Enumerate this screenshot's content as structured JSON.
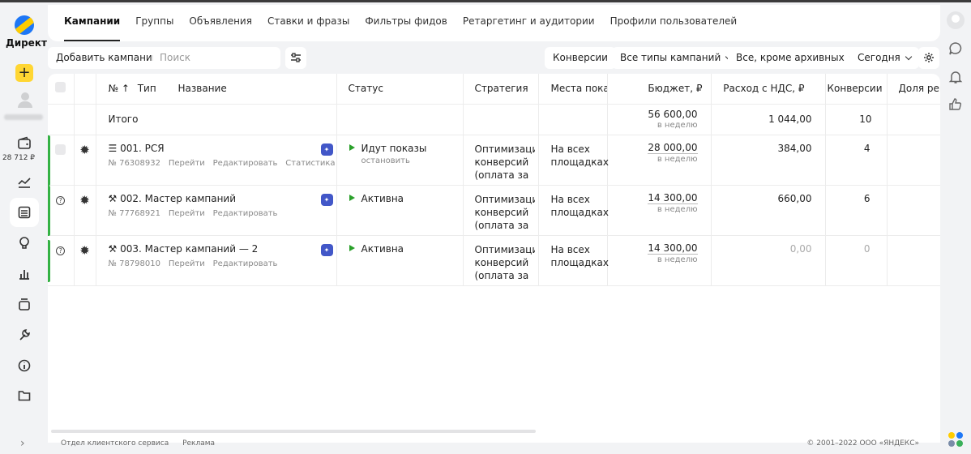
{
  "brand": {
    "name": "Директ"
  },
  "sidebar": {
    "balance": "28 712 ₽"
  },
  "tabs": [
    "Кампании",
    "Группы",
    "Объявления",
    "Ставки и фразы",
    "Фильтры фидов",
    "Ретаргетинг и аудитории",
    "Профили пользователей"
  ],
  "toolbar": {
    "add_campaign": "Добавить кампанию",
    "search_placeholder": "Поиск",
    "conversions": "Конверсии",
    "campaign_types": "Все типы кампаний",
    "archive_filter": "Все, кроме архивных",
    "period": "Сегодня"
  },
  "table": {
    "headers": {
      "num": "№",
      "type": "Тип",
      "name": "Название",
      "status": "Статус",
      "strategy": "Стратегия",
      "placements": "Места показ",
      "budget": "Бюджет, ₽",
      "spend": "Расход с НДС, ₽",
      "conversions": "Конверсии",
      "share": "Доля рекл"
    },
    "total": {
      "label": "Итого",
      "budget": "56 600,00",
      "budget_period": "в неделю",
      "spend": "1 044,00",
      "conversions": "10"
    },
    "rows": [
      {
        "name": "001. РСЯ",
        "id": "№ 76308932",
        "links": [
          "Перейти",
          "Редактировать",
          "Статистика"
        ],
        "status": "Идут показы",
        "status_action": "остановить",
        "strategy": "Оптимизация конверсий (оплата за",
        "placements": "На всех площадках",
        "budget": "28 000,00",
        "budget_period": "в неделю",
        "spend": "384,00",
        "conversions": "4"
      },
      {
        "name": "002. Мастер кампаний",
        "id": "№ 77768921",
        "links": [
          "Перейти",
          "Редактировать"
        ],
        "status": "Активна",
        "status_action": "",
        "strategy": "Оптимизация конверсий (оплата за",
        "placements": "На всех площадках",
        "budget": "14 300,00",
        "budget_period": "в неделю",
        "spend": "660,00",
        "conversions": "6"
      },
      {
        "name": "003. Мастер кампаний — 2",
        "id": "№ 78798010",
        "links": [
          "Перейти",
          "Редактировать"
        ],
        "status": "Активна",
        "status_action": "",
        "strategy": "Оптимизация конверсий (оплата за",
        "placements": "На всех площадках",
        "budget": "14 300,00",
        "budget_period": "в неделю",
        "spend": "0,00",
        "conversions": "0"
      }
    ]
  },
  "footer": {
    "links": [
      "Отдел клиентского сервиса",
      "Реклама"
    ],
    "copyright": "© 2001–2022 ООО «ЯНДЕКС»"
  }
}
